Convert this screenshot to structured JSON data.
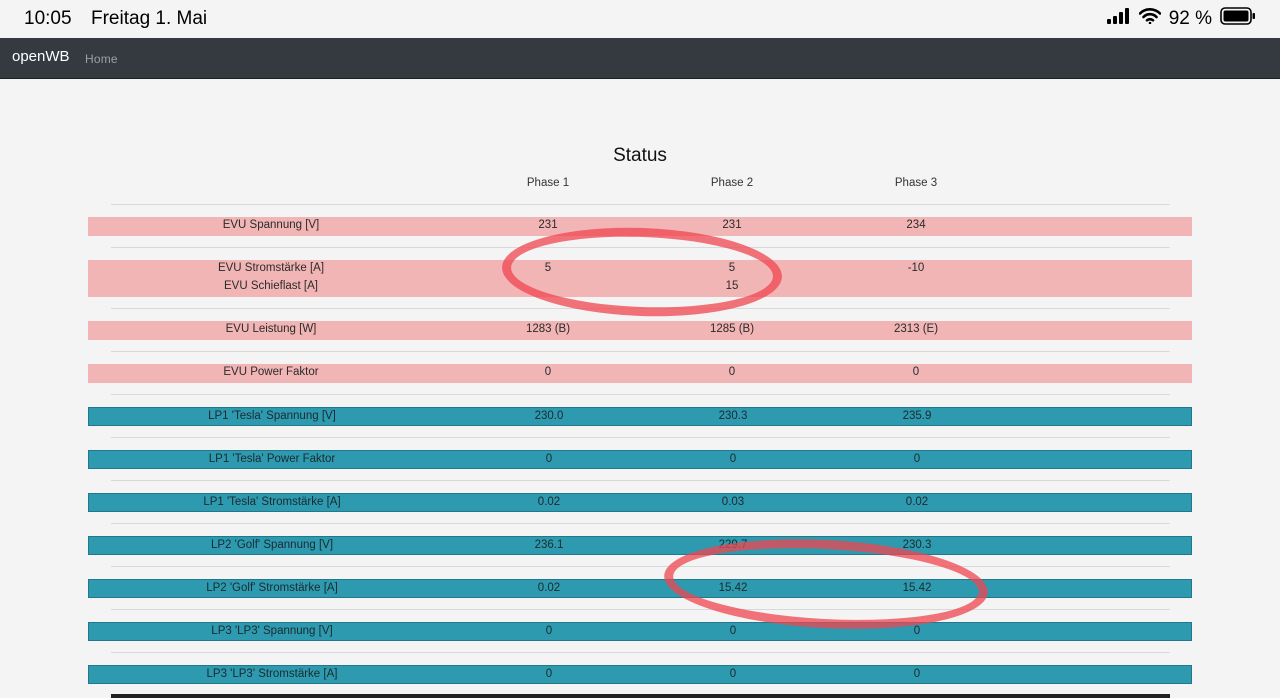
{
  "statusbar": {
    "time": "10:05",
    "date": "Freitag 1. Mai",
    "battery": "92 %",
    "icons": [
      "signal-icon",
      "wifi-icon",
      "battery-icon"
    ]
  },
  "navbar": {
    "brand": "openWB",
    "home": "Home"
  },
  "page": {
    "title": "Status",
    "phases": [
      "Phase 1",
      "Phase 2",
      "Phase 3"
    ]
  },
  "rows": [
    {
      "type": "evu",
      "labels": [
        "EVU Spannung [V]"
      ],
      "values": [
        [
          "231"
        ],
        [
          "231"
        ],
        [
          "234"
        ]
      ]
    },
    {
      "type": "evu",
      "labels": [
        "EVU Stromstärke [A]",
        "EVU Schieflast [A]"
      ],
      "values": [
        [
          "5"
        ],
        [
          "5",
          "15"
        ],
        [
          "-10"
        ]
      ]
    },
    {
      "type": "evu",
      "labels": [
        "EVU Leistung [W]"
      ],
      "values": [
        [
          "1283 (B)"
        ],
        [
          "1285 (B)"
        ],
        [
          "2313 (E)"
        ]
      ]
    },
    {
      "type": "evu",
      "labels": [
        "EVU Power Faktor"
      ],
      "values": [
        [
          "0"
        ],
        [
          "0"
        ],
        [
          "0"
        ]
      ]
    },
    {
      "type": "lp",
      "labels": [
        "LP1 'Tesla' Spannung [V]"
      ],
      "values": [
        [
          "230.0"
        ],
        [
          "230.3"
        ],
        [
          "235.9"
        ]
      ]
    },
    {
      "type": "lp",
      "labels": [
        "LP1 'Tesla' Power Faktor"
      ],
      "values": [
        [
          "0"
        ],
        [
          "0"
        ],
        [
          "0"
        ]
      ]
    },
    {
      "type": "lp",
      "labels": [
        "LP1 'Tesla' Stromstärke [A]"
      ],
      "values": [
        [
          "0.02"
        ],
        [
          "0.03"
        ],
        [
          "0.02"
        ]
      ]
    },
    {
      "type": "lp",
      "labels": [
        "LP2 'Golf' Spannung [V]"
      ],
      "values": [
        [
          "236.1"
        ],
        [
          "229.7"
        ],
        [
          "230.3"
        ]
      ]
    },
    {
      "type": "lp",
      "labels": [
        "LP2 'Golf' Stromstärke [A]"
      ],
      "values": [
        [
          "0.02"
        ],
        [
          "15.42"
        ],
        [
          "15.42"
        ]
      ]
    },
    {
      "type": "lp",
      "labels": [
        "LP3 'LP3' Spannung [V]"
      ],
      "values": [
        [
          "0"
        ],
        [
          "0"
        ],
        [
          "0"
        ]
      ]
    },
    {
      "type": "lp",
      "labels": [
        "LP3 'LP3' Stromstärke [A]"
      ],
      "values": [
        [
          "0"
        ],
        [
          "0"
        ],
        [
          "0"
        ]
      ]
    }
  ],
  "colors": {
    "evu_row": "#f2b5b5",
    "lp_row": "#2e9aaf",
    "navbar": "#343a40",
    "annotation": "#f04650"
  }
}
